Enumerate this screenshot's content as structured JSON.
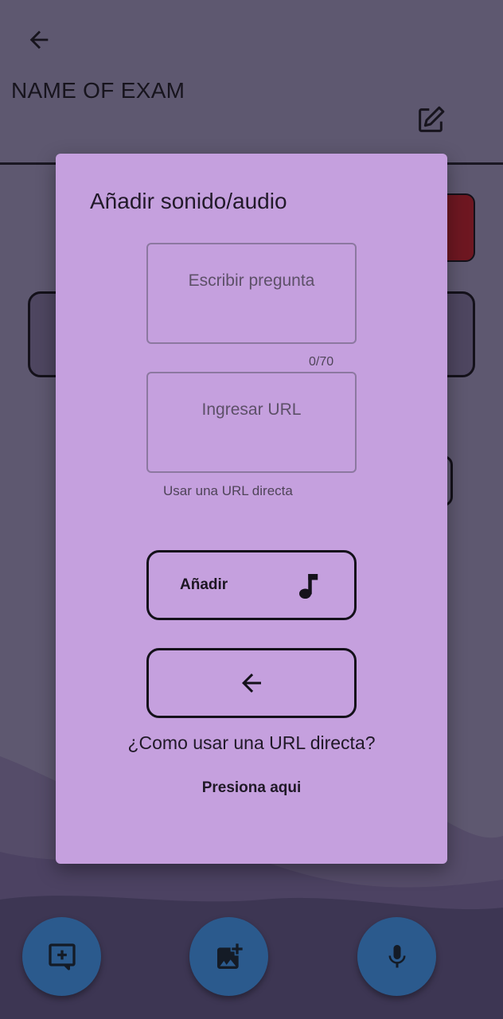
{
  "header": {
    "title": "NAME OF EXAM",
    "back_icon": "arrow-left-icon",
    "edit_icon": "edit-note-icon"
  },
  "fabs": [
    {
      "icon": "add-comment-icon"
    },
    {
      "icon": "add-photo-icon"
    },
    {
      "icon": "mic-icon"
    }
  ],
  "dialog": {
    "title": "Añadir sonido/audio",
    "question_field": {
      "placeholder": "Escribir pregunta",
      "value": "",
      "counter": "0/70"
    },
    "url_field": {
      "placeholder": "Ingresar URL",
      "value": "",
      "helper": "Usar una URL directa"
    },
    "add_button": {
      "label": "Añadir",
      "icon": "music-note-icon"
    },
    "back_button": {
      "icon": "arrow-left-icon"
    },
    "help_question": "¿Como usar una URL directa?",
    "help_link": "Presiona aqui"
  },
  "colors": {
    "dialog_bg": "#c5a0de",
    "fab_bg": "#2b5a8d",
    "overlay_bg": "#5e5870",
    "accent_red": "#6e1721"
  }
}
